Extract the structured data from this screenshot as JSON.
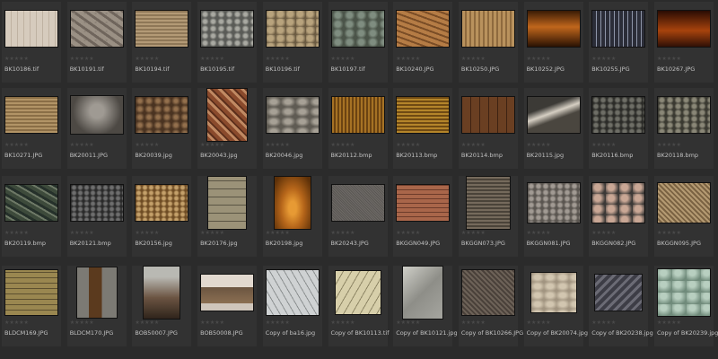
{
  "thumbnails": [
    {
      "name": "BK10186.tif",
      "rating": "★★★★★"
    },
    {
      "name": "BK10191.tif",
      "rating": "★★★★★"
    },
    {
      "name": "BK10194.tif",
      "rating": "★★★★★"
    },
    {
      "name": "BK10195.tif",
      "rating": "★★★★★"
    },
    {
      "name": "BK10196.tif",
      "rating": "★★★★★"
    },
    {
      "name": "BK10197.tif",
      "rating": "★★★★★"
    },
    {
      "name": "BK10240.JPG",
      "rating": "★★★★★"
    },
    {
      "name": "BK10250.JPG",
      "rating": "★★★★★"
    },
    {
      "name": "BK10252.JPG",
      "rating": "★★★★★"
    },
    {
      "name": "BK10255.JPG",
      "rating": "★★★★★"
    },
    {
      "name": "BK10267.JPG",
      "rating": "★★★★★"
    },
    {
      "name": "BK10271.JPG",
      "rating": "★★★★★"
    },
    {
      "name": "BK20011.JPG",
      "rating": "★★★★★"
    },
    {
      "name": "BK20039.jpg",
      "rating": "★★★★★"
    },
    {
      "name": "BK20043.jpg",
      "rating": "★★★★★"
    },
    {
      "name": "BK20046.jpg",
      "rating": "★★★★★"
    },
    {
      "name": "BK20112.bmp",
      "rating": "★★★★★"
    },
    {
      "name": "BK20113.bmp",
      "rating": "★★★★★"
    },
    {
      "name": "BK20114.bmp",
      "rating": "★★★★★"
    },
    {
      "name": "BK20115.jpg",
      "rating": "★★★★★"
    },
    {
      "name": "BK20116.bmp",
      "rating": "★★★★★"
    },
    {
      "name": "BK20118.bmp",
      "rating": "★★★★★"
    },
    {
      "name": "BK20119.bmp",
      "rating": "★★★★★"
    },
    {
      "name": "BK20121.bmp",
      "rating": "★★★★★"
    },
    {
      "name": "BK20156.jpg",
      "rating": "★★★★★"
    },
    {
      "name": "BK20176.jpg",
      "rating": "★★★★★"
    },
    {
      "name": "BK20198.jpg",
      "rating": "★★★★★"
    },
    {
      "name": "BK20243.JPG",
      "rating": "★★★★★"
    },
    {
      "name": "BKGGN049.JPG",
      "rating": "★★★★★"
    },
    {
      "name": "BKGGN073.JPG",
      "rating": "★★★★★"
    },
    {
      "name": "BKGGN081.JPG",
      "rating": "★★★★★"
    },
    {
      "name": "BKGGN082.JPG",
      "rating": "★★★★★"
    },
    {
      "name": "BKGGN095.JPG",
      "rating": "★★★★★"
    },
    {
      "name": "BLDCM169.JPG",
      "rating": "★★★★★"
    },
    {
      "name": "BLDCM170.JPG",
      "rating": "★★★★★"
    },
    {
      "name": "BOB50007.JPG",
      "rating": "★★★★★"
    },
    {
      "name": "BOB50008.JPG",
      "rating": "★★★★★"
    },
    {
      "name": "Copy of ba16.jpg",
      "rating": "★★★★★"
    },
    {
      "name": "Copy of BK10113.tif",
      "rating": "★★★★★"
    },
    {
      "name": "Copy of BK10121.jpg",
      "rating": "★★★★★"
    },
    {
      "name": "Copy of BK10266.JPG",
      "rating": "★★★★★"
    },
    {
      "name": "Copy of BK20074.jpg",
      "rating": "★★★★★"
    },
    {
      "name": "Copy of BK20238.jpg",
      "rating": "★★★★★"
    },
    {
      "name": "Copy of BK20239.jpg",
      "rating": "★★★★★"
    }
  ],
  "colors": {
    "background": "#2b2b2b",
    "cell": "#323232",
    "label": "#c2c2c2",
    "stars": "#4a4a4a"
  }
}
